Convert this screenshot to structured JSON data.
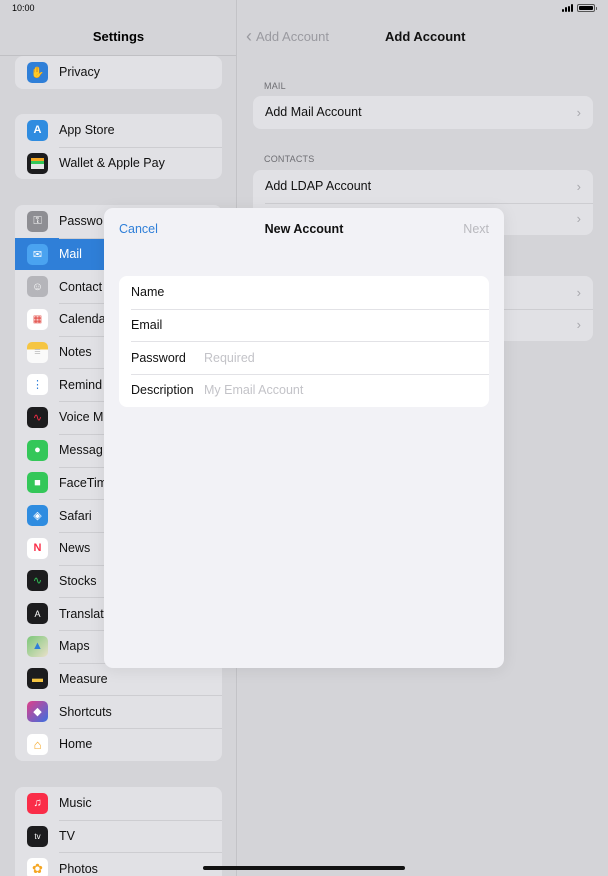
{
  "status": {
    "time": "10:00"
  },
  "left": {
    "title": "Settings",
    "groups": [
      {
        "items": [
          {
            "label": "Privacy",
            "icon": "hand-icon",
            "color": "#2f7fd8",
            "glyph": "✋"
          }
        ]
      },
      {
        "items": [
          {
            "label": "App Store",
            "icon": "app-store-icon",
            "color": "#2f8ce0",
            "glyph": "A"
          },
          {
            "label": "Wallet & Apple Pay",
            "icon": "wallet-icon",
            "color": "#1c1c1e",
            "glyph": "▤"
          }
        ]
      },
      {
        "items": [
          {
            "label": "Passwo",
            "icon": "key-icon",
            "color": "#8e8e93",
            "glyph": "⚿"
          },
          {
            "label": "Mail",
            "icon": "mail-icon",
            "color": "#2f8ce0",
            "glyph": "✉"
          },
          {
            "label": "Contact",
            "icon": "contacts-icon",
            "color": "#a8a8ad",
            "glyph": "☺"
          },
          {
            "label": "Calenda",
            "icon": "calendar-icon",
            "color": "#ffffff",
            "glyph": "▦"
          },
          {
            "label": "Notes",
            "icon": "notes-icon",
            "color": "#f5c542",
            "glyph": "≡"
          },
          {
            "label": "Remind",
            "icon": "reminders-icon",
            "color": "#ffffff",
            "glyph": "⋮"
          },
          {
            "label": "Voice M",
            "icon": "voice-memos-icon",
            "color": "#1c1c1e",
            "glyph": "∿"
          },
          {
            "label": "Messag",
            "icon": "messages-icon",
            "color": "#34c759",
            "glyph": "●"
          },
          {
            "label": "FaceTim",
            "icon": "facetime-icon",
            "color": "#34c759",
            "glyph": "■"
          },
          {
            "label": "Safari",
            "icon": "safari-icon",
            "color": "#2f8ce0",
            "glyph": "◈"
          },
          {
            "label": "News",
            "icon": "news-icon",
            "color": "#ffffff",
            "glyph": "N"
          },
          {
            "label": "Stocks",
            "icon": "stocks-icon",
            "color": "#1c1c1e",
            "glyph": "∿"
          },
          {
            "label": "Translat",
            "icon": "translate-icon",
            "color": "#1c1c1e",
            "glyph": "A"
          },
          {
            "label": "Maps",
            "icon": "maps-icon",
            "color": "#5fb96a",
            "glyph": "▲"
          },
          {
            "label": "Measure",
            "icon": "measure-icon",
            "color": "#1c1c1e",
            "glyph": "▬"
          },
          {
            "label": "Shortcuts",
            "icon": "shortcuts-icon",
            "color": "#7b4fd6",
            "glyph": "◆"
          },
          {
            "label": "Home",
            "icon": "home-icon",
            "color": "#ffffff",
            "glyph": "⌂"
          }
        ]
      },
      {
        "items": [
          {
            "label": "Music",
            "icon": "music-icon",
            "color": "#fa2d48",
            "glyph": "♫"
          },
          {
            "label": "TV",
            "icon": "tv-icon",
            "color": "#1c1c1e",
            "glyph": "tv"
          },
          {
            "label": "Photos",
            "icon": "photos-icon",
            "color": "#ffffff",
            "glyph": "✿"
          }
        ]
      }
    ]
  },
  "right": {
    "back_label": "Add Account",
    "title": "Add Account",
    "mail_header": "MAIL",
    "mail_rows": [
      "Add Mail Account"
    ],
    "contacts_header": "CONTACTS",
    "contacts_rows": [
      "Add LDAP Account",
      ""
    ],
    "other_rows": [
      "",
      ""
    ]
  },
  "modal": {
    "cancel": "Cancel",
    "title": "New Account",
    "next": "Next",
    "fields": [
      {
        "label": "Name",
        "value": "",
        "placeholder": ""
      },
      {
        "label": "Email",
        "value": "",
        "placeholder": ""
      },
      {
        "label": "Password",
        "value": "",
        "placeholder": "Required"
      },
      {
        "label": "Description",
        "value": "",
        "placeholder": "My Email Account"
      }
    ]
  }
}
